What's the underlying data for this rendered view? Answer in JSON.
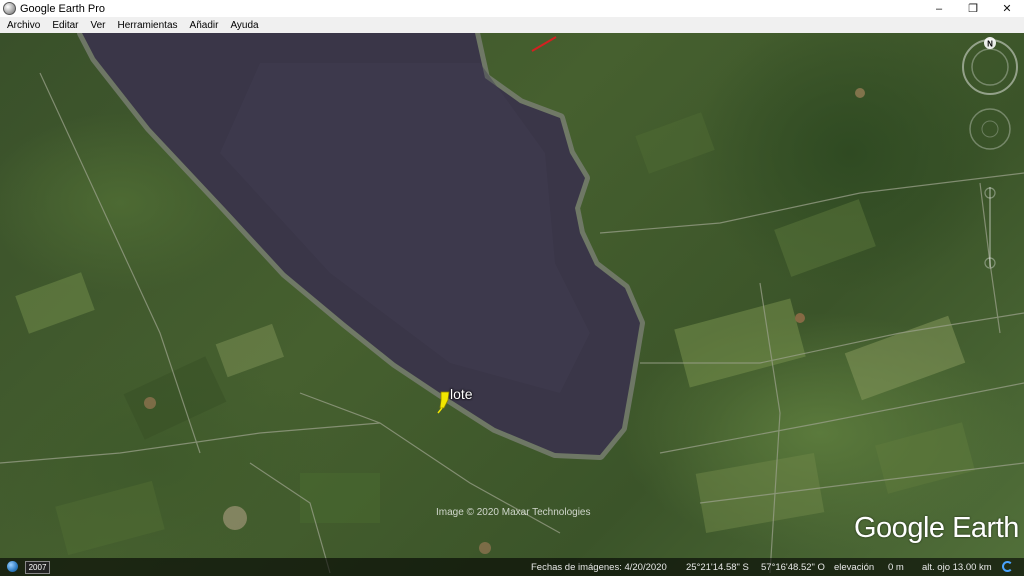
{
  "window": {
    "title": "Google Earth Pro",
    "icon": "google-earth-globe-icon",
    "controls": {
      "minimize": "–",
      "restore": "❐",
      "close": "✕"
    }
  },
  "menu": {
    "items": [
      {
        "label": "Archivo"
      },
      {
        "label": "Editar"
      },
      {
        "label": "Ver"
      },
      {
        "label": "Herramientas"
      },
      {
        "label": "Añadir"
      },
      {
        "label": "Ayuda"
      }
    ]
  },
  "map": {
    "placemark": {
      "label": "lote",
      "color": "#f2e600",
      "icon": "pushpin-icon"
    },
    "imagery_credit": "Image © 2020 Maxar Technologies",
    "logo": "Google Earth",
    "compass_label": "N",
    "colors": {
      "water": "#3a3648",
      "shore": "#7a7f74",
      "road": "#9aa08a"
    }
  },
  "status": {
    "year_badge": "2007",
    "imagery_date": "Fechas de imágenes: 4/20/2020",
    "latitude": "25°21'14.58\" S",
    "longitude": "57°16'48.52\" O",
    "elevation_label": "elevación",
    "elevation_value": "0 m",
    "eye_alt": "alt. ojo  13.00 km"
  }
}
